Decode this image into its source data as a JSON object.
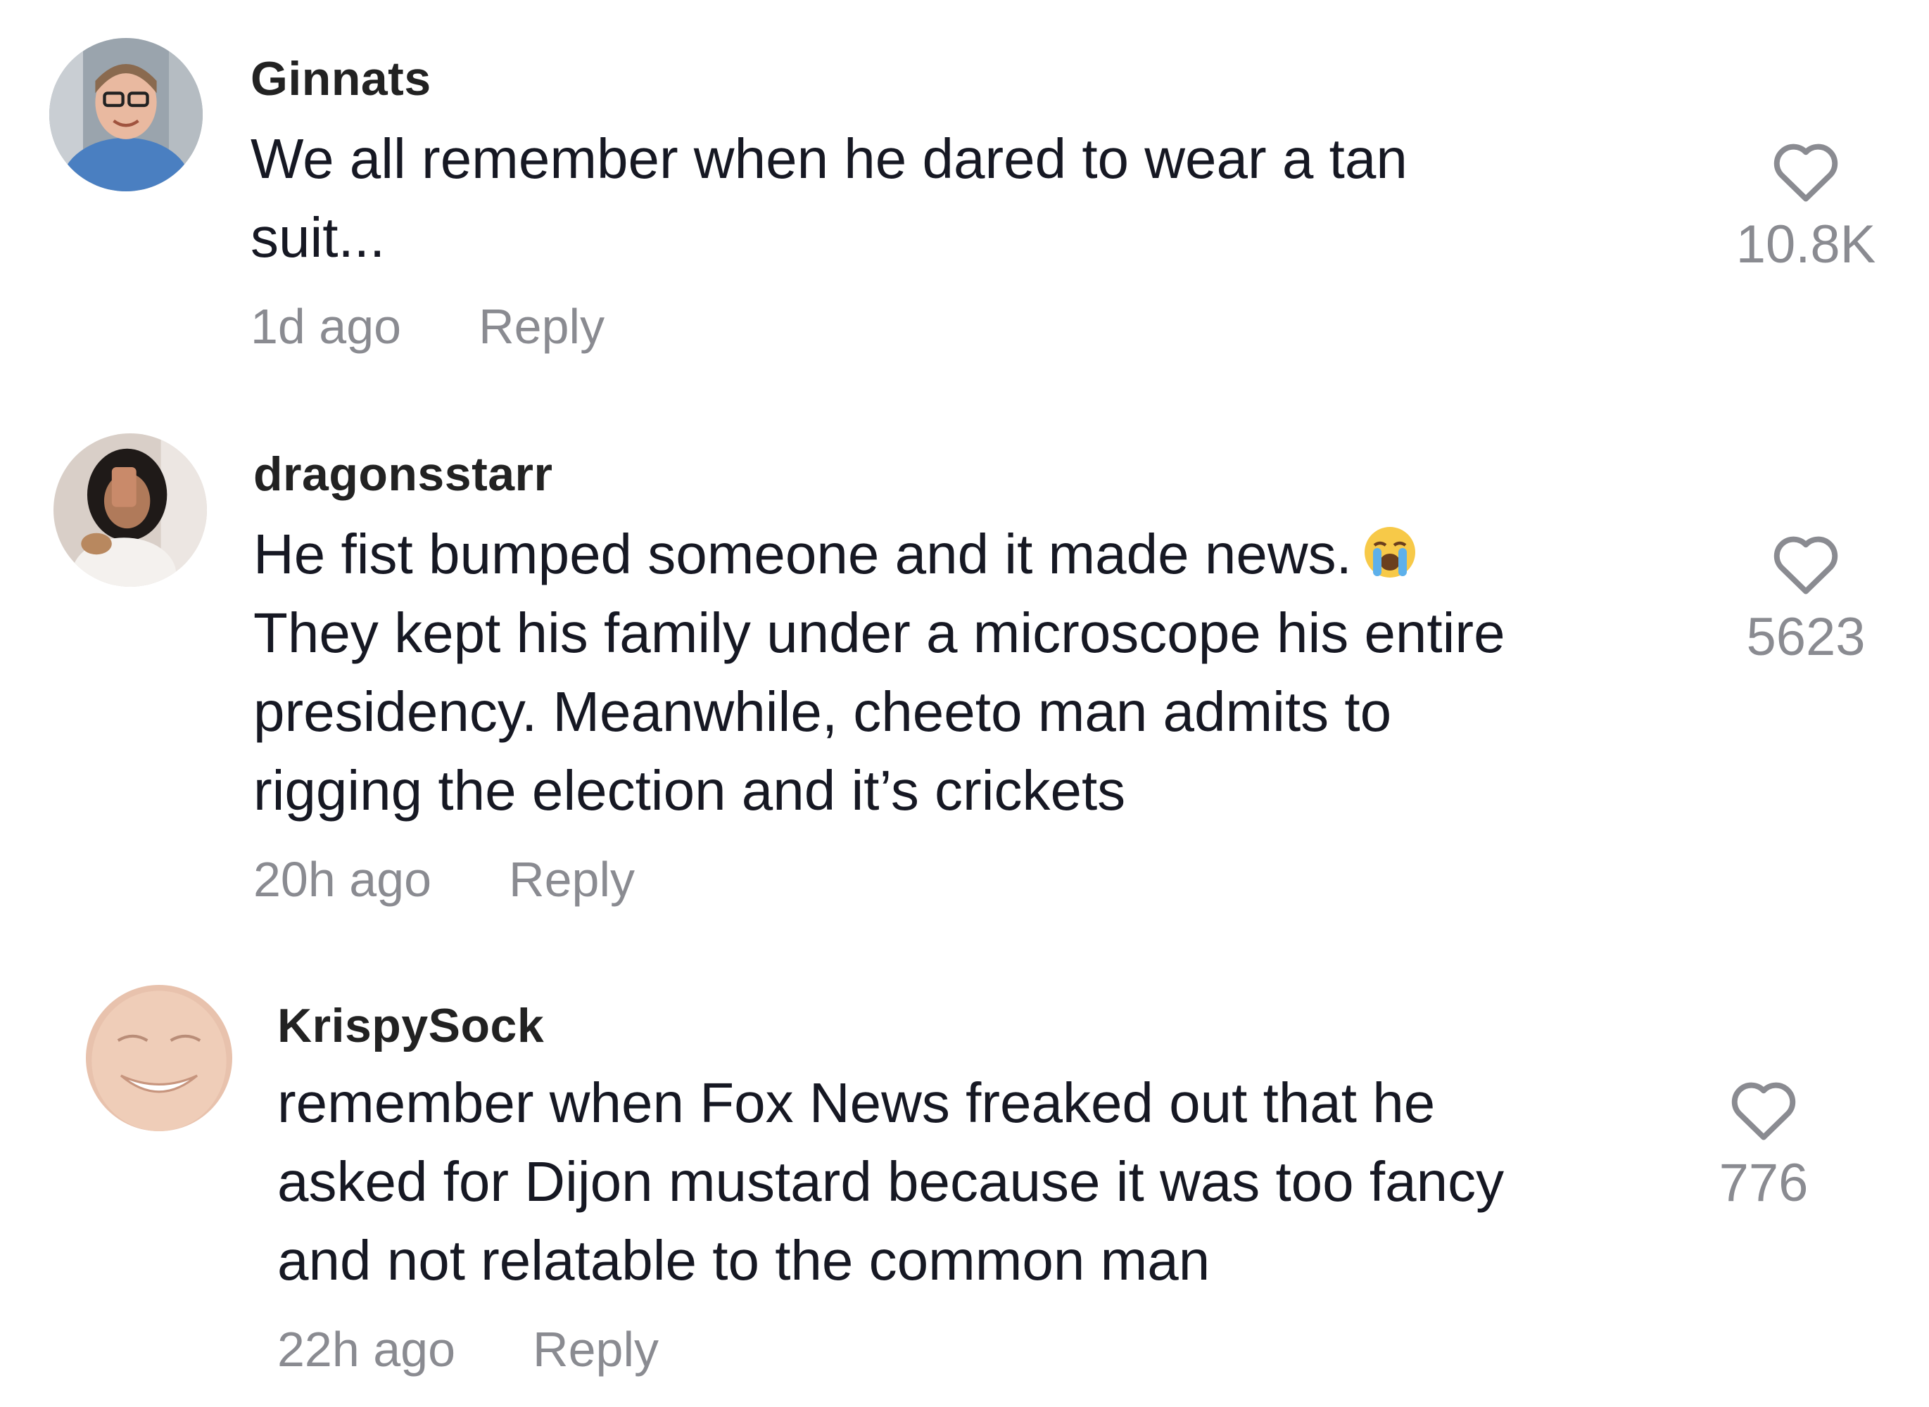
{
  "comments": [
    {
      "username": "Ginnats",
      "lines": [
        "We all remember when he dared to wear a tan",
        "suit..."
      ],
      "time": "1d ago",
      "reply_label": "Reply",
      "likes": "10.8K",
      "avatar_icon": "avatar-photo-icon"
    },
    {
      "username": "dragonsstarr",
      "lines": [
        "He fist bumped someone and it made news.",
        "They kept his family under a microscope his entire",
        "presidency. Meanwhile, cheeto man admits to",
        "rigging the election and it’s crickets"
      ],
      "emoji": "😭",
      "time": "20h ago",
      "reply_label": "Reply",
      "likes": "5623",
      "avatar_icon": "avatar-photo-icon"
    },
    {
      "username": "KrispySock",
      "lines": [
        "remember when Fox News freaked out that he",
        "asked for Dijon mustard because it was too fancy",
        "and not relatable to the common man"
      ],
      "time": "22h ago",
      "reply_label": "Reply",
      "likes": "776",
      "avatar_icon": "avatar-photo-icon"
    }
  ],
  "colors": {
    "text": "#161823",
    "username": "#222222",
    "muted": "#8a8b91"
  },
  "icons": {
    "like": "heart-outline-icon",
    "emoji": "loudly-crying-face-emoji"
  }
}
